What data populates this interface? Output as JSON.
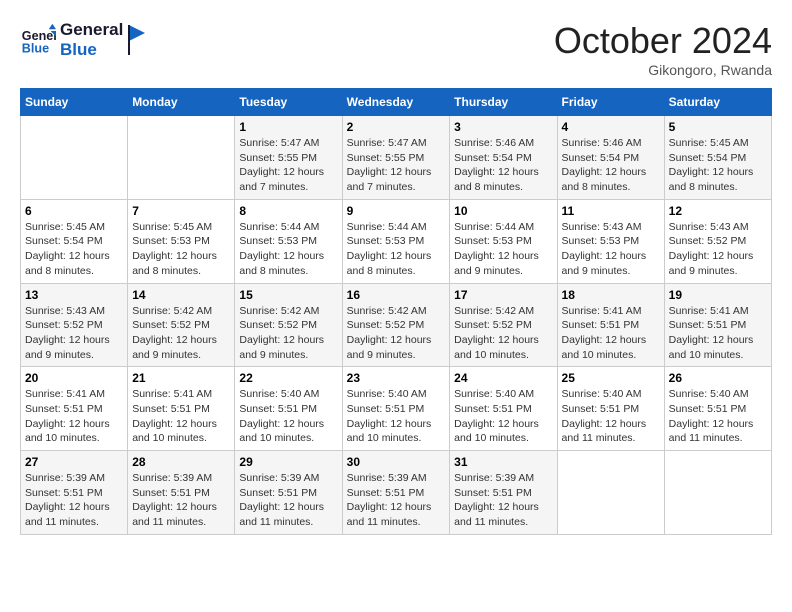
{
  "header": {
    "logo_general": "General",
    "logo_blue": "Blue",
    "month": "October 2024",
    "location": "Gikongoro, Rwanda"
  },
  "days_of_week": [
    "Sunday",
    "Monday",
    "Tuesday",
    "Wednesday",
    "Thursday",
    "Friday",
    "Saturday"
  ],
  "weeks": [
    [
      null,
      null,
      {
        "day": 1,
        "sunrise": "5:47 AM",
        "sunset": "5:55 PM",
        "daylight": "12 hours and 7 minutes."
      },
      {
        "day": 2,
        "sunrise": "5:47 AM",
        "sunset": "5:55 PM",
        "daylight": "12 hours and 7 minutes."
      },
      {
        "day": 3,
        "sunrise": "5:46 AM",
        "sunset": "5:54 PM",
        "daylight": "12 hours and 8 minutes."
      },
      {
        "day": 4,
        "sunrise": "5:46 AM",
        "sunset": "5:54 PM",
        "daylight": "12 hours and 8 minutes."
      },
      {
        "day": 5,
        "sunrise": "5:45 AM",
        "sunset": "5:54 PM",
        "daylight": "12 hours and 8 minutes."
      }
    ],
    [
      {
        "day": 6,
        "sunrise": "5:45 AM",
        "sunset": "5:54 PM",
        "daylight": "12 hours and 8 minutes."
      },
      {
        "day": 7,
        "sunrise": "5:45 AM",
        "sunset": "5:53 PM",
        "daylight": "12 hours and 8 minutes."
      },
      {
        "day": 8,
        "sunrise": "5:44 AM",
        "sunset": "5:53 PM",
        "daylight": "12 hours and 8 minutes."
      },
      {
        "day": 9,
        "sunrise": "5:44 AM",
        "sunset": "5:53 PM",
        "daylight": "12 hours and 8 minutes."
      },
      {
        "day": 10,
        "sunrise": "5:44 AM",
        "sunset": "5:53 PM",
        "daylight": "12 hours and 9 minutes."
      },
      {
        "day": 11,
        "sunrise": "5:43 AM",
        "sunset": "5:53 PM",
        "daylight": "12 hours and 9 minutes."
      },
      {
        "day": 12,
        "sunrise": "5:43 AM",
        "sunset": "5:52 PM",
        "daylight": "12 hours and 9 minutes."
      }
    ],
    [
      {
        "day": 13,
        "sunrise": "5:43 AM",
        "sunset": "5:52 PM",
        "daylight": "12 hours and 9 minutes."
      },
      {
        "day": 14,
        "sunrise": "5:42 AM",
        "sunset": "5:52 PM",
        "daylight": "12 hours and 9 minutes."
      },
      {
        "day": 15,
        "sunrise": "5:42 AM",
        "sunset": "5:52 PM",
        "daylight": "12 hours and 9 minutes."
      },
      {
        "day": 16,
        "sunrise": "5:42 AM",
        "sunset": "5:52 PM",
        "daylight": "12 hours and 9 minutes."
      },
      {
        "day": 17,
        "sunrise": "5:42 AM",
        "sunset": "5:52 PM",
        "daylight": "12 hours and 10 minutes."
      },
      {
        "day": 18,
        "sunrise": "5:41 AM",
        "sunset": "5:51 PM",
        "daylight": "12 hours and 10 minutes."
      },
      {
        "day": 19,
        "sunrise": "5:41 AM",
        "sunset": "5:51 PM",
        "daylight": "12 hours and 10 minutes."
      }
    ],
    [
      {
        "day": 20,
        "sunrise": "5:41 AM",
        "sunset": "5:51 PM",
        "daylight": "12 hours and 10 minutes."
      },
      {
        "day": 21,
        "sunrise": "5:41 AM",
        "sunset": "5:51 PM",
        "daylight": "12 hours and 10 minutes."
      },
      {
        "day": 22,
        "sunrise": "5:40 AM",
        "sunset": "5:51 PM",
        "daylight": "12 hours and 10 minutes."
      },
      {
        "day": 23,
        "sunrise": "5:40 AM",
        "sunset": "5:51 PM",
        "daylight": "12 hours and 10 minutes."
      },
      {
        "day": 24,
        "sunrise": "5:40 AM",
        "sunset": "5:51 PM",
        "daylight": "12 hours and 10 minutes."
      },
      {
        "day": 25,
        "sunrise": "5:40 AM",
        "sunset": "5:51 PM",
        "daylight": "12 hours and 11 minutes."
      },
      {
        "day": 26,
        "sunrise": "5:40 AM",
        "sunset": "5:51 PM",
        "daylight": "12 hours and 11 minutes."
      }
    ],
    [
      {
        "day": 27,
        "sunrise": "5:39 AM",
        "sunset": "5:51 PM",
        "daylight": "12 hours and 11 minutes."
      },
      {
        "day": 28,
        "sunrise": "5:39 AM",
        "sunset": "5:51 PM",
        "daylight": "12 hours and 11 minutes."
      },
      {
        "day": 29,
        "sunrise": "5:39 AM",
        "sunset": "5:51 PM",
        "daylight": "12 hours and 11 minutes."
      },
      {
        "day": 30,
        "sunrise": "5:39 AM",
        "sunset": "5:51 PM",
        "daylight": "12 hours and 11 minutes."
      },
      {
        "day": 31,
        "sunrise": "5:39 AM",
        "sunset": "5:51 PM",
        "daylight": "12 hours and 11 minutes."
      },
      null,
      null
    ]
  ]
}
